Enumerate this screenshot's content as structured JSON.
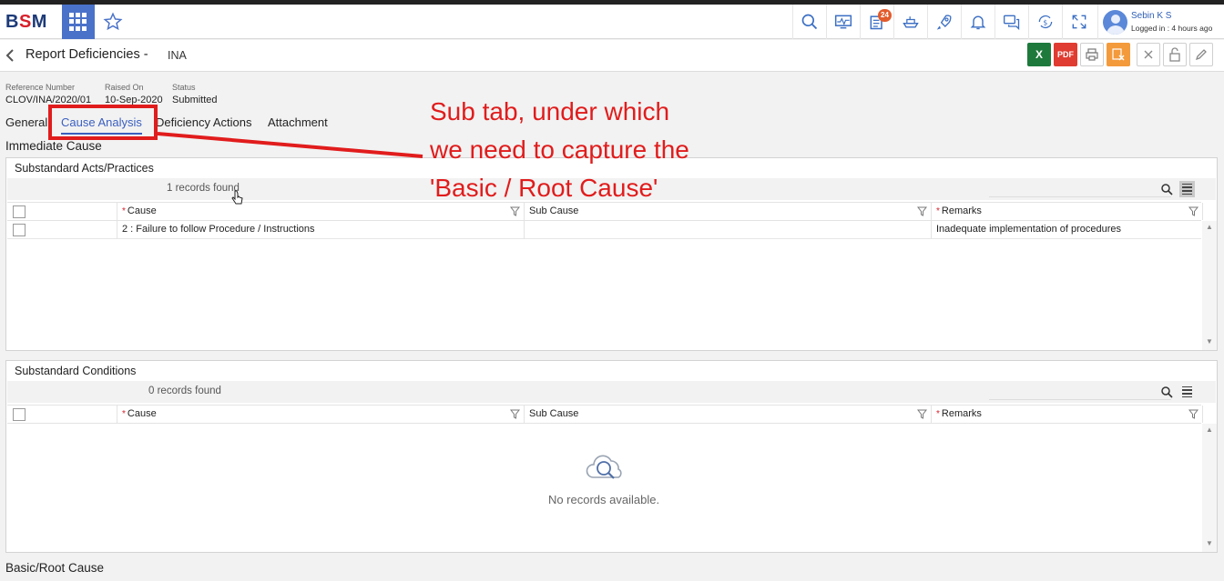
{
  "app": {
    "logo": {
      "prefix": "B",
      "mark": "S",
      "suffix": "M"
    },
    "notifications_count": "24",
    "user": {
      "name": "Sebin K S",
      "logged_in": "Logged in : 4 hours ago"
    }
  },
  "page": {
    "title": "Report Deficiencies -",
    "subtitle": "INA",
    "meta": [
      {
        "label": "Reference Number",
        "value": "CLOV/INA/2020/01"
      },
      {
        "label": "Raised On",
        "value": "10-Sep-2020"
      },
      {
        "label": "Status",
        "value": "Submitted"
      }
    ],
    "tabs": [
      "General",
      "Cause Analysis",
      "Deficiency Actions",
      "Attachment"
    ],
    "active_tab": "Cause Analysis"
  },
  "immediate_cause": {
    "heading": "Immediate Cause",
    "acts": {
      "title": "Substandard Acts/Practices",
      "records": "1 records found",
      "columns": [
        "Cause",
        "Sub Cause",
        "Remarks"
      ],
      "rows": [
        {
          "cause": "2 : Failure to follow Procedure / Instructions",
          "sub_cause": "",
          "remarks": "Inadequate implementation of procedures"
        }
      ]
    },
    "conditions": {
      "title": "Substandard Conditions",
      "records": "0 records found",
      "columns": [
        "Cause",
        "Sub Cause",
        "Remarks"
      ],
      "empty": "No records available."
    }
  },
  "basic_root_cause": {
    "heading": "Basic/Root Cause"
  },
  "annotation": {
    "lines": [
      "Sub tab, under which",
      "we need to capture the",
      "'Basic / Root Cause'"
    ],
    "color": "#e11c1c"
  },
  "icons": {
    "topbar": [
      "search-icon",
      "monitor-icon",
      "clipboard-icon",
      "ship-icon",
      "rocket-icon",
      "bell-icon",
      "chat-icon",
      "currency-sync-icon",
      "fullscreen-icon"
    ],
    "actions": [
      "excel-icon",
      "pdf-icon",
      "print-icon",
      "clear-icon",
      "close-icon",
      "unlock-icon",
      "edit-icon"
    ]
  }
}
